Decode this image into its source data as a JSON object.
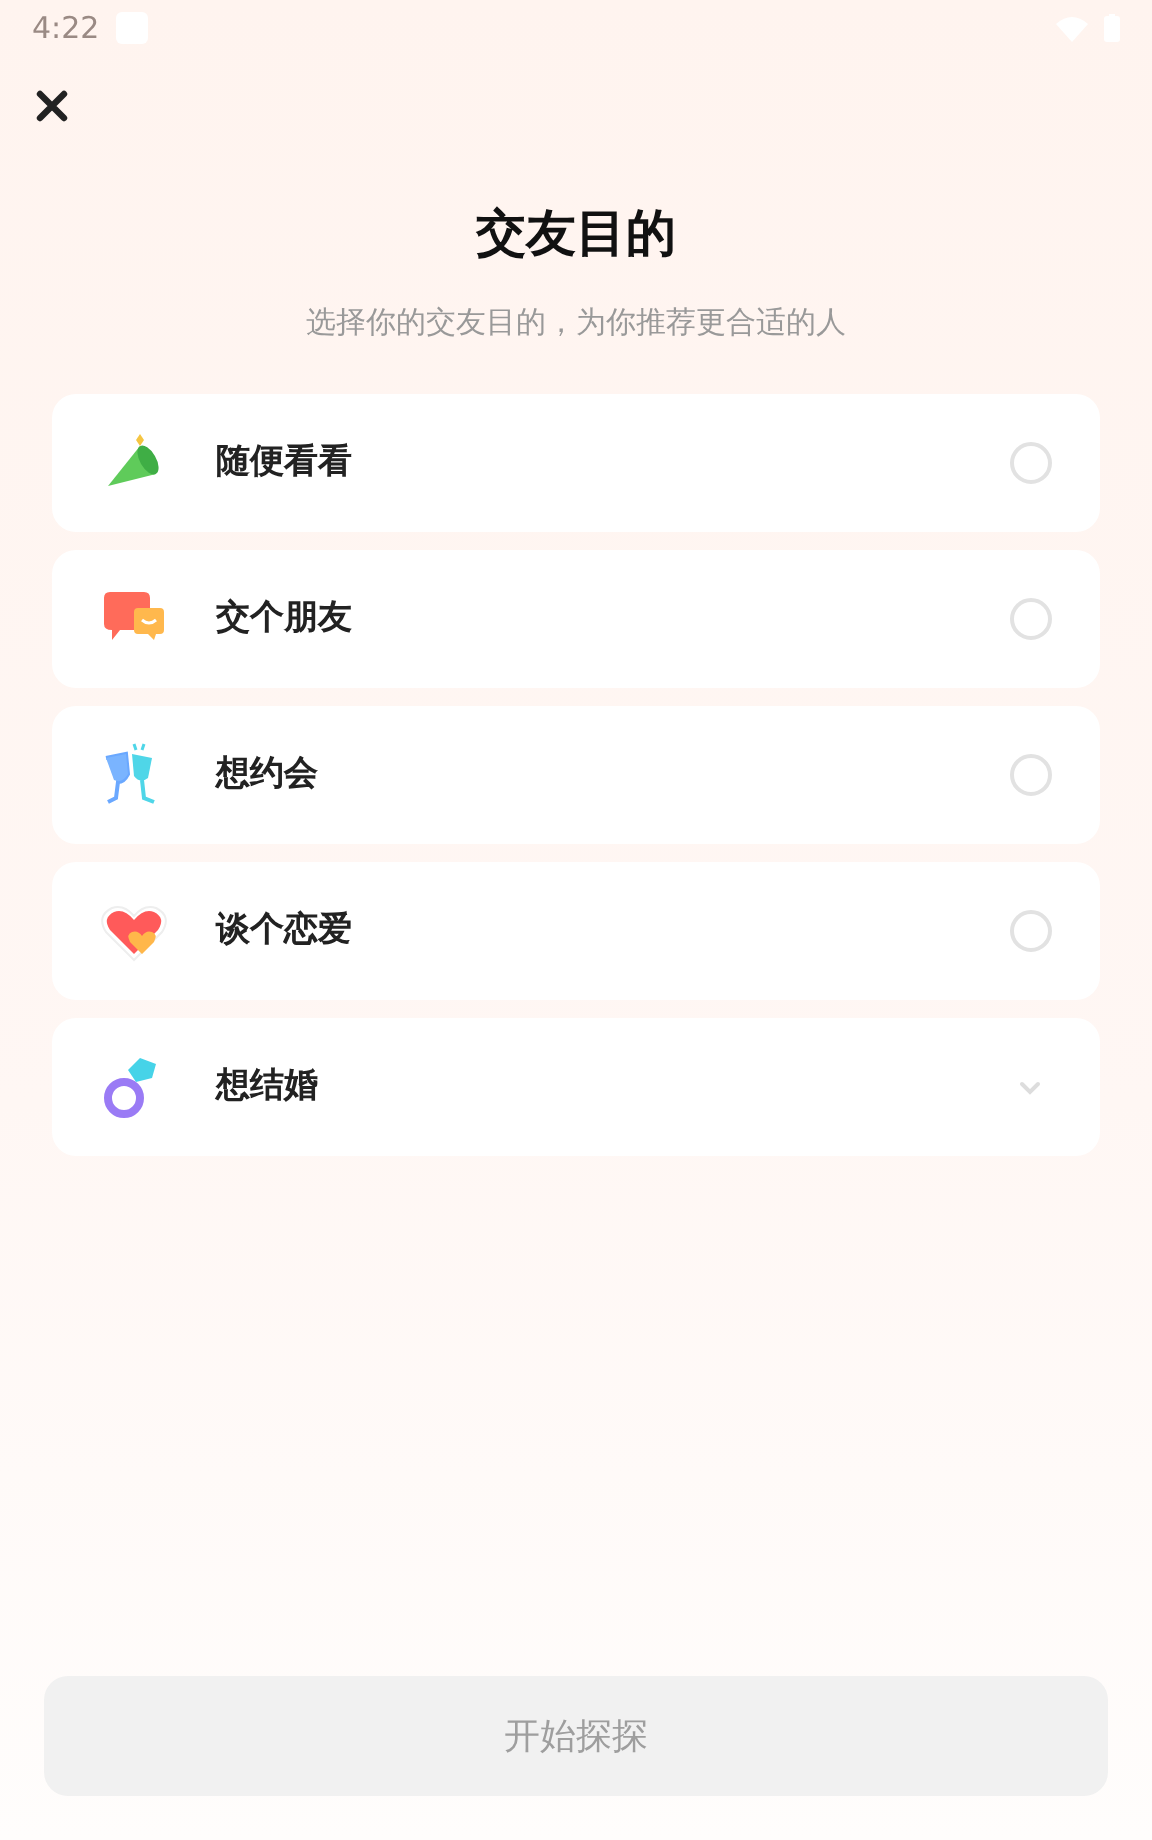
{
  "status_bar": {
    "time": "4:22"
  },
  "title": "交友目的",
  "subtitle": "选择你的交友目的，为你推荐更合适的人",
  "options": [
    {
      "label": "随便看看",
      "kind": "radio",
      "selected": false
    },
    {
      "label": "交个朋友",
      "kind": "radio",
      "selected": false
    },
    {
      "label": "想约会",
      "kind": "radio",
      "selected": false
    },
    {
      "label": "谈个恋爱",
      "kind": "radio",
      "selected": false
    },
    {
      "label": "想结婚",
      "kind": "chevron"
    }
  ],
  "start_button": {
    "label": "开始探探",
    "disabled": true
  }
}
